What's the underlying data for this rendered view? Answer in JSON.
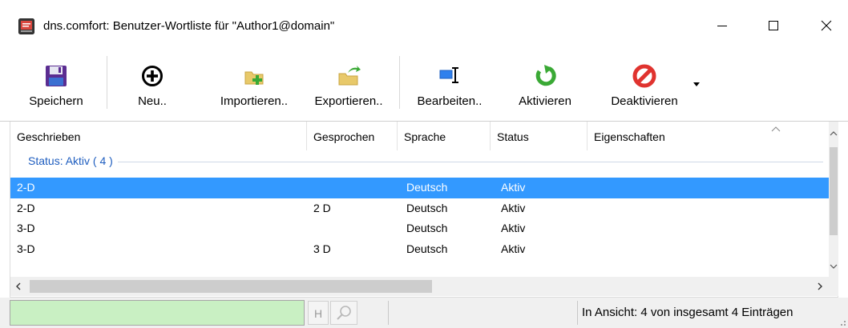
{
  "window": {
    "title": "dns.comfort: Benutzer-Wortliste für \"Author1@domain\""
  },
  "toolbar": {
    "save_label": "Speichern",
    "new_label": "Neu..",
    "import_label": "Importieren..",
    "export_label": "Exportieren..",
    "edit_label": "Bearbeiten..",
    "activate_label": "Aktivieren",
    "deactivate_label": "Deaktivieren"
  },
  "table": {
    "columns": [
      "Geschrieben",
      "Gesprochen",
      "Sprache",
      "Status",
      "Eigenschaften"
    ],
    "group_label": "Status: Aktiv ( 4 )",
    "rows": [
      {
        "geschrieben": "2-D",
        "gesprochen": "",
        "sprache": "Deutsch",
        "status": "Aktiv",
        "selected": true
      },
      {
        "geschrieben": "2-D",
        "gesprochen": "2 D",
        "sprache": "Deutsch",
        "status": "Aktiv",
        "selected": false
      },
      {
        "geschrieben": "3-D",
        "gesprochen": "",
        "sprache": "Deutsch",
        "status": "Aktiv",
        "selected": false
      },
      {
        "geschrieben": "3-D",
        "gesprochen": "3 D",
        "sprache": "Deutsch",
        "status": "Aktiv",
        "selected": false
      }
    ]
  },
  "statusbar": {
    "h_button": "H",
    "summary": "In Ansicht: 4 von insgesamt 4 Einträgen"
  },
  "colors": {
    "selection": "#3399ff",
    "group_text": "#1e5dbf",
    "status_green": "#c9f0c3",
    "activate_green": "#3aa935",
    "deactivate_red": "#e0332f"
  },
  "icons": [
    "app-icon",
    "save-icon",
    "add-circle-icon",
    "import-icon",
    "export-icon",
    "edit-icon",
    "activate-icon",
    "deactivate-icon",
    "dropdown-arrow-icon",
    "search-icon"
  ]
}
